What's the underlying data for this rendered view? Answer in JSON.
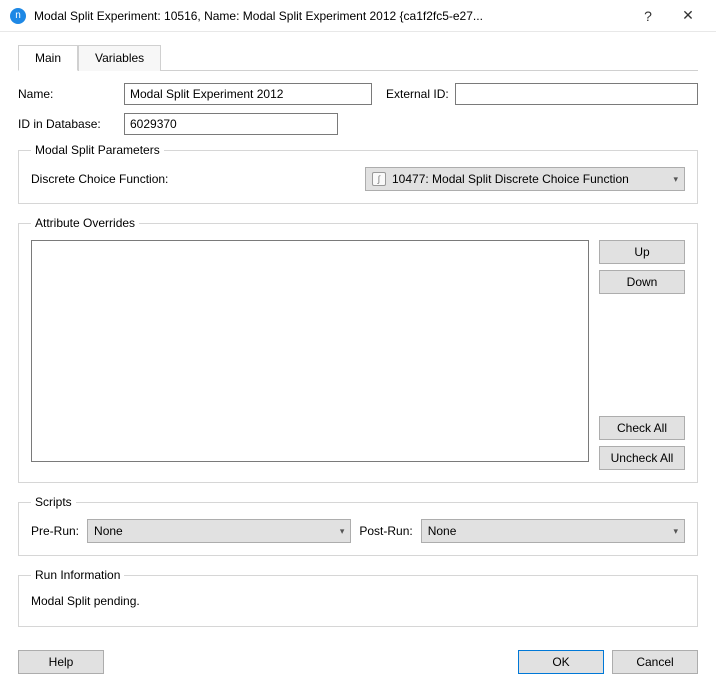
{
  "titlebar": {
    "icon_letter": "n",
    "title": "Modal Split Experiment: 10516, Name: Modal Split Experiment 2012  {ca1f2fc5-e27...",
    "help": "?",
    "close": "✕"
  },
  "tabs": {
    "main": "Main",
    "variables": "Variables"
  },
  "fields": {
    "name_label": "Name:",
    "name_value": "Modal Split Experiment 2012",
    "extid_label": "External ID:",
    "extid_value": "",
    "dbid_label": "ID in Database:",
    "dbid_value": "6029370"
  },
  "modal_split": {
    "legend": "Modal Split Parameters",
    "dcf_label": "Discrete Choice Function:",
    "dcf_selected": "10477: Modal Split Discrete Choice Function"
  },
  "attr": {
    "legend": "Attribute Overrides",
    "up": "Up",
    "down": "Down",
    "check_all": "Check All",
    "uncheck_all": "Uncheck All"
  },
  "scripts": {
    "legend": "Scripts",
    "pre_label": "Pre-Run:",
    "pre_value": "None",
    "post_label": "Post-Run:",
    "post_value": "None"
  },
  "run_info": {
    "legend": "Run Information",
    "text": "Modal Split pending."
  },
  "footer": {
    "help": "Help",
    "ok": "OK",
    "cancel": "Cancel"
  }
}
